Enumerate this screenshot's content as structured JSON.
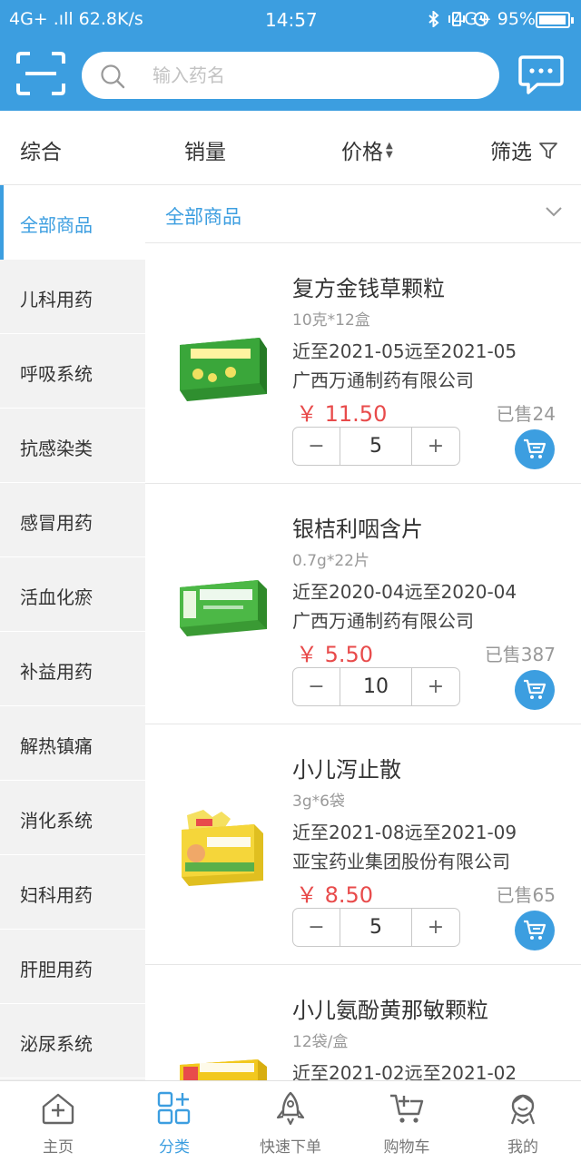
{
  "status_bar": {
    "left": "4G+ .ıll 62.8K/s",
    "time": "14:57",
    "right": "4G+ 95%",
    "battery_percent": 95
  },
  "header": {
    "search_placeholder": "输入药名",
    "scan_icon": "scan-icon",
    "message_icon": "message-icon"
  },
  "sort_bar": {
    "overall": "综合",
    "sales": "销量",
    "price": "价格",
    "filter": "筛选"
  },
  "sidebar": {
    "items": [
      {
        "label": "全部商品",
        "active": true
      },
      {
        "label": "儿科用药"
      },
      {
        "label": "呼吸系统"
      },
      {
        "label": "抗感染类"
      },
      {
        "label": "感冒用药"
      },
      {
        "label": "活血化瘀"
      },
      {
        "label": "补益用药"
      },
      {
        "label": "解热镇痛"
      },
      {
        "label": "消化系统"
      },
      {
        "label": "妇科用药"
      },
      {
        "label": "肝胆用药"
      },
      {
        "label": "泌尿系统"
      }
    ]
  },
  "filter_header": {
    "label": "全部商品"
  },
  "products": [
    {
      "name": "复方金钱草颗粒",
      "spec": "10克*12盒",
      "expiry": "近至2021-05远至2021-05",
      "maker": "广西万通制药有限公司",
      "price": "￥ 11.50",
      "sold": "已售24",
      "qty": "5",
      "box_color": "#3aa63a",
      "box_label": "复方金钱草颗粒"
    },
    {
      "name": "银桔利咽含片",
      "spec": "0.7g*22片",
      "expiry": "近至2020-04远至2020-04",
      "maker": "广西万通制药有限公司",
      "price": "￥ 5.50",
      "sold": "已售387",
      "qty": "10",
      "box_color": "#46b040",
      "box_label": "银桔利咽含片"
    },
    {
      "name": "小儿泻止散",
      "spec": "3g*6袋",
      "expiry": "近至2021-08远至2021-09",
      "maker": "亚宝药业集团股份有限公司",
      "price": "￥ 8.50",
      "sold": "已售65",
      "qty": "5",
      "box_color": "#f5d63a",
      "box_label": "小儿泻止散"
    },
    {
      "name": "小儿氨酚黄那敏颗粒",
      "spec": "12袋/盒",
      "expiry": "近至2021-02远至2021-02",
      "maker": "",
      "price": "",
      "sold": "",
      "qty": "",
      "box_color": "#f2c81e",
      "box_label": "小儿氨酚黄那敏颗粒"
    }
  ],
  "stepper": {
    "minus": "−",
    "plus": "+"
  },
  "bottom_nav": {
    "items": [
      {
        "label": "主页",
        "icon": "home-icon"
      },
      {
        "label": "分类",
        "icon": "category-icon",
        "active": true
      },
      {
        "label": "快速下单",
        "icon": "rocket-icon"
      },
      {
        "label": "购物车",
        "icon": "cart-icon"
      },
      {
        "label": "我的",
        "icon": "profile-icon"
      }
    ]
  },
  "colors": {
    "accent": "#3c9ee0",
    "price": "#e84b4b",
    "sidebar_bg": "#f2f2f2"
  }
}
